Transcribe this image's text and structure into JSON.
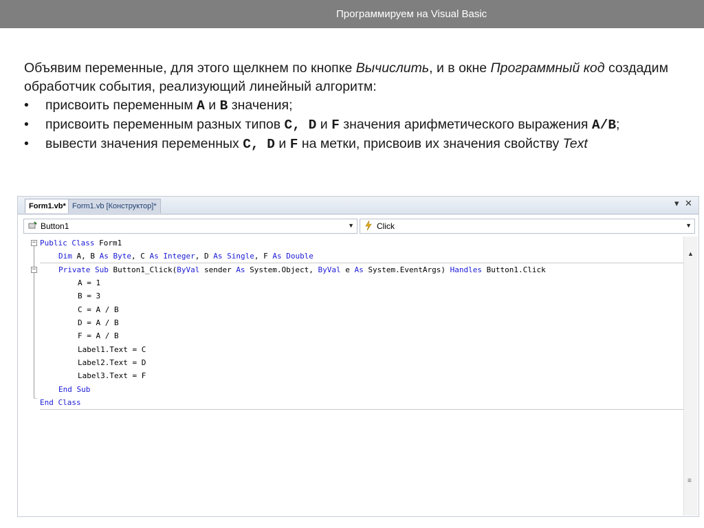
{
  "header": {
    "title": "Программируем на Visual Basic"
  },
  "slide": {
    "para_part1": "Объявим переменные, для этого щелкнем по кнопке ",
    "para_em1": "Вычислить",
    "para_part2": ", и в окне ",
    "para_em2": "Программный код",
    "para_part3": " создадим обработчик события, реализующий линейный алгоритм:",
    "bullet_char": "•",
    "b1_text1": "присвоить переменным ",
    "b1_code1": "A",
    "b1_text2": " и ",
    "b1_code2": "B",
    "b1_text3": " значения;",
    "b2_text1": "присвоить переменным разных типов ",
    "b2_code1": "C, D",
    "b2_text2": " и ",
    "b2_code2": "F",
    "b2_text3": " значения арифметического выражения ",
    "b2_code3": "A/B",
    "b2_text4": ";",
    "b3_text1": "вывести значения переменных ",
    "b3_code1": "C, D",
    "b3_text2": " и ",
    "b3_code2": "F",
    "b3_text3": " на метки, присвоив их значения свойству ",
    "b3_em": "Text"
  },
  "ide": {
    "tabs": [
      {
        "label": "Form1.vb*"
      },
      {
        "label": "Form1.vb [Конструктор]*"
      }
    ],
    "tab_dropdown_icon": "▾",
    "tab_close_icon": "✕",
    "object_dropdown": {
      "value": "Button1",
      "icon": "button-object-icon"
    },
    "event_dropdown": {
      "value": "Click",
      "icon": "lightning-event-icon"
    },
    "code": {
      "l1_kw1": "Public Class",
      "l1_t1": " Form1",
      "l2_kw1": "Dim",
      "l2_t1": " A, B ",
      "l2_kw2": "As Byte",
      "l2_t2": ", C ",
      "l2_kw3": "As Integer",
      "l2_t3": ", D ",
      "l2_kw4": "As Single",
      "l2_t4": ", F ",
      "l2_kw5": "As Double",
      "l3_kw1": "Private Sub",
      "l3_t1": " Button1_Click(",
      "l3_kw2": "ByVal",
      "l3_t2": " sender ",
      "l3_kw3": "As",
      "l3_t3": " System.Object, ",
      "l3_kw4": "ByVal",
      "l3_t4": " e ",
      "l3_kw5": "As",
      "l3_t5": " System.EventArgs) ",
      "l3_kw6": "Handles",
      "l3_t6": " Button1.Click",
      "body": [
        "A = 1",
        "B = 3",
        "C = A / B",
        "D = A / B",
        "F = A / B",
        "Label1.Text = C",
        "Label2.Text = D",
        "Label3.Text = F"
      ],
      "end_sub": "End Sub",
      "end_class": "End Class"
    },
    "fold_symbol": "−"
  }
}
